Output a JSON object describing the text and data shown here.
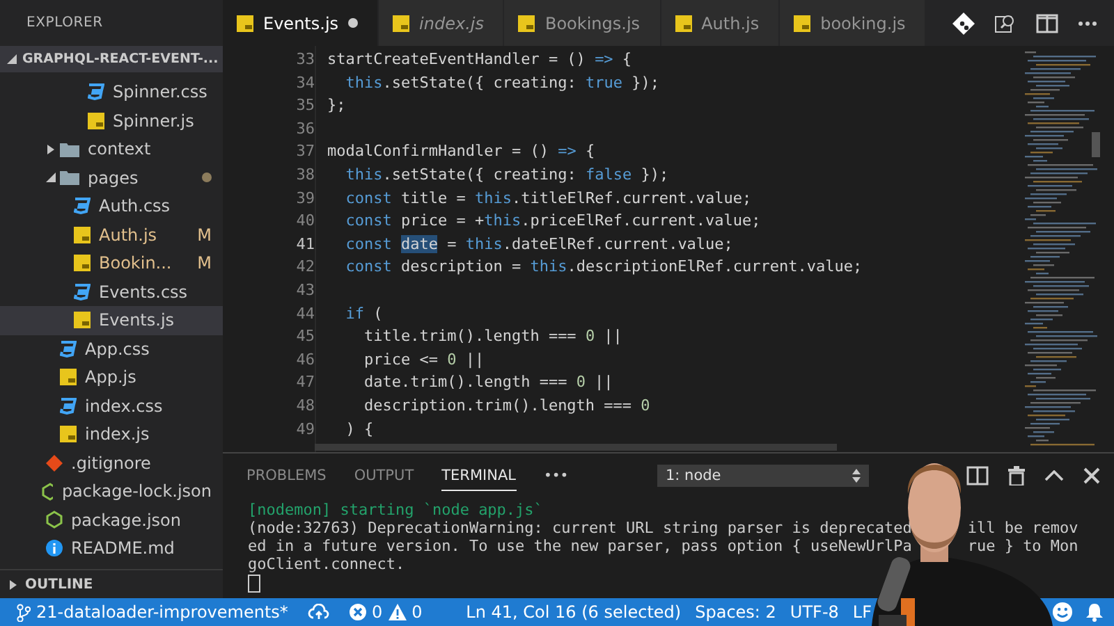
{
  "sidebar": {
    "title": "EXPLORER",
    "root": {
      "label": "GRAPHQL-REACT-EVENT-...",
      "expanded": true
    },
    "tree": [
      {
        "children": [
          {
            "children": [
              {
                "children": [
                  {
                    "label": "Spinner.css",
                    "kind": "css"
                  },
                  {
                    "label": "Spinner.js",
                    "kind": "js"
                  }
                ]
              }
            ]
          },
          {
            "label": "context",
            "kind": "folder",
            "expanded": false
          },
          {
            "label": "pages",
            "kind": "folder",
            "expanded": true,
            "modified": true,
            "children": [
              {
                "label": "Auth.css",
                "kind": "css"
              },
              {
                "label": "Auth.js",
                "kind": "js",
                "badge": "M"
              },
              {
                "label": "Bookin...",
                "kind": "js",
                "badge": "M"
              },
              {
                "label": "Events.css",
                "kind": "css"
              },
              {
                "label": "Events.js",
                "kind": "js",
                "selected": true
              }
            ]
          },
          {
            "label": "App.css",
            "kind": "css"
          },
          {
            "label": "App.js",
            "kind": "js"
          },
          {
            "label": "index.css",
            "kind": "css"
          },
          {
            "label": "index.js",
            "kind": "js"
          }
        ]
      },
      {
        "label": ".gitignore",
        "kind": "git"
      },
      {
        "label": "package-lock.json",
        "kind": "npm"
      },
      {
        "label": "package.json",
        "kind": "npm"
      },
      {
        "label": "README.md",
        "kind": "info"
      }
    ],
    "outline": {
      "label": "OUTLINE",
      "expanded": false
    }
  },
  "tabs": [
    {
      "label": "Events.js",
      "selected": true,
      "modified": true,
      "preview": false
    },
    {
      "label": "index.js",
      "selected": false,
      "modified": false,
      "preview": true
    },
    {
      "label": "Bookings.js",
      "selected": false,
      "modified": false,
      "preview": false
    },
    {
      "label": "Auth.js",
      "selected": false,
      "modified": false,
      "preview": false
    },
    {
      "label": "booking.js",
      "selected": false,
      "modified": false,
      "preview": false
    }
  ],
  "editor": {
    "lines": [
      {
        "number": "33",
        "active": false,
        "tokens": [
          {
            "text": "startCreateEventHandler = () ",
            "kind": "plain"
          },
          {
            "text": "=>",
            "kind": "keyword"
          },
          {
            "text": " {",
            "kind": "plain"
          }
        ]
      },
      {
        "number": "34",
        "active": false,
        "tokens": [
          {
            "text": "  this",
            "kind": "keyword"
          },
          {
            "text": ".setState({ creating: ",
            "kind": "plain"
          },
          {
            "text": "true",
            "kind": "keyword"
          },
          {
            "text": " });",
            "kind": "plain"
          }
        ]
      },
      {
        "number": "35",
        "active": false,
        "tokens": [
          {
            "text": "};",
            "kind": "plain"
          }
        ]
      },
      {
        "number": "36",
        "active": false
      },
      {
        "number": "37",
        "active": false,
        "tokens": [
          {
            "text": "modalConfirmHandler = () ",
            "kind": "plain"
          },
          {
            "text": "=>",
            "kind": "keyword"
          },
          {
            "text": " {",
            "kind": "plain"
          }
        ]
      },
      {
        "number": "38",
        "active": false,
        "tokens": [
          {
            "text": "  this",
            "kind": "keyword"
          },
          {
            "text": ".setState({ creating: ",
            "kind": "plain"
          },
          {
            "text": "false",
            "kind": "keyword"
          },
          {
            "text": " });",
            "kind": "plain"
          }
        ]
      },
      {
        "number": "39",
        "active": false,
        "tokens": [
          {
            "text": "  const",
            "kind": "keyword"
          },
          {
            "text": " title = ",
            "kind": "plain"
          },
          {
            "text": "this",
            "kind": "keyword"
          },
          {
            "text": ".titleElRef.current.value;",
            "kind": "plain"
          }
        ]
      },
      {
        "number": "40",
        "active": false,
        "tokens": [
          {
            "text": "  const",
            "kind": "keyword"
          },
          {
            "text": " price = +",
            "kind": "plain"
          },
          {
            "text": "this",
            "kind": "keyword"
          },
          {
            "text": ".priceElRef.current.value;",
            "kind": "plain"
          }
        ]
      },
      {
        "number": "41",
        "active": true,
        "tokens": [
          {
            "text": "  const ",
            "kind": "keyword"
          },
          {
            "text": "date",
            "kind": "plain",
            "selected": true
          },
          {
            "text": " = ",
            "kind": "plain"
          },
          {
            "text": "this",
            "kind": "keyword"
          },
          {
            "text": ".dateElRef.current.value;",
            "kind": "plain"
          }
        ]
      },
      {
        "number": "42",
        "active": false,
        "tokens": [
          {
            "text": "  const",
            "kind": "keyword"
          },
          {
            "text": " description = ",
            "kind": "plain"
          },
          {
            "text": "this",
            "kind": "keyword"
          },
          {
            "text": ".descriptionElRef.current.value;",
            "kind": "plain"
          }
        ]
      },
      {
        "number": "43",
        "active": false
      },
      {
        "number": "44",
        "active": false,
        "tokens": [
          {
            "text": "  if",
            "kind": "keyword"
          },
          {
            "text": " (",
            "kind": "plain"
          }
        ]
      },
      {
        "number": "45",
        "active": false,
        "tokens": [
          {
            "text": "    title.trim().length === ",
            "kind": "plain"
          },
          {
            "text": "0",
            "kind": "number"
          },
          {
            "text": " ||",
            "kind": "plain"
          }
        ]
      },
      {
        "number": "46",
        "active": false,
        "tokens": [
          {
            "text": "    price <= ",
            "kind": "plain"
          },
          {
            "text": "0",
            "kind": "number"
          },
          {
            "text": " ||",
            "kind": "plain"
          }
        ]
      },
      {
        "number": "47",
        "active": false,
        "tokens": [
          {
            "text": "    date.trim().length === ",
            "kind": "plain"
          },
          {
            "text": "0",
            "kind": "number"
          },
          {
            "text": " ||",
            "kind": "plain"
          }
        ]
      },
      {
        "number": "48",
        "active": false,
        "tokens": [
          {
            "text": "    description.trim().length === ",
            "kind": "plain"
          },
          {
            "text": "0",
            "kind": "number"
          }
        ]
      },
      {
        "number": "49",
        "active": false,
        "tokens": [
          {
            "text": "  ) {",
            "kind": "plain"
          }
        ]
      }
    ]
  },
  "panel": {
    "tabs": [
      {
        "label": "PROBLEMS",
        "selected": false
      },
      {
        "label": "OUTPUT",
        "selected": false
      },
      {
        "label": "TERMINAL",
        "selected": true
      }
    ],
    "more": "•••",
    "terminal_select": "1: node",
    "lines": [
      {
        "kind": "info",
        "segments": [
          "[nodemon] starting `node app.js`"
        ]
      },
      {
        "kind": "plain",
        "segments": [
          "(node:32763) DeprecationWarning: current URL string parser is deprecated",
          "ill be remov"
        ]
      },
      {
        "kind": "plain",
        "segments": [
          "ed in a future version. To use the new parser, pass option { useNewUrlPa",
          "rue } to Mon"
        ]
      },
      {
        "kind": "plain",
        "segments": [
          "goClient.connect."
        ]
      }
    ]
  },
  "status_bar": {
    "branch": "21-dataloader-improvements*",
    "errors": "0",
    "warnings": "0",
    "position": "Ln 41, Col 16 (6 selected)",
    "spaces": "Spaces: 2",
    "encoding": "UTF-8",
    "eol": "LF"
  }
}
